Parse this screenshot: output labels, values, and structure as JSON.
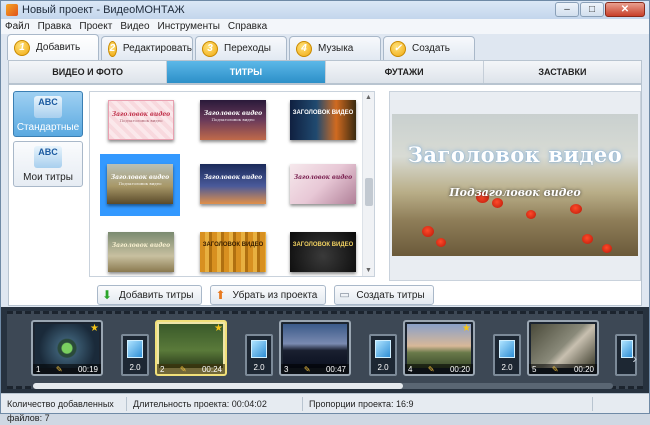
{
  "window": {
    "title": "Новый проект - ВидеоМОНТАЖ"
  },
  "menu": [
    "Файл",
    "Правка",
    "Проект",
    "Видео",
    "Инструменты",
    "Справка"
  ],
  "steps": [
    {
      "num": "1",
      "label": "Добавить"
    },
    {
      "num": "2",
      "label": "Редактировать"
    },
    {
      "num": "3",
      "label": "Переходы"
    },
    {
      "num": "4",
      "label": "Музыка"
    },
    {
      "num": "✓",
      "label": "Создать"
    }
  ],
  "subtabs": [
    "ВИДЕО И ФОТО",
    "ТИТРЫ",
    "ФУТАЖИ",
    "ЗАСТАВКИ"
  ],
  "leftnav": [
    {
      "icon": "ABC",
      "label": "Стандартные"
    },
    {
      "icon": "ABC",
      "label": "Мои титры"
    }
  ],
  "gallery": [
    {
      "title": "Заголовок видео",
      "sub": "Подзаголовок видео"
    },
    {
      "title": "Заголовок видео",
      "sub": "Подзаголовок видео"
    },
    {
      "title": "ЗАГОЛОВОК ВИДЕО",
      "sub": ""
    },
    {
      "title": "Заголовок видео",
      "sub": "Подзаголовок видео"
    },
    {
      "title": "Заголовок видео",
      "sub": ""
    },
    {
      "title": "Заголовок видео",
      "sub": ""
    },
    {
      "title": "Заголовок видео",
      "sub": ""
    },
    {
      "title": "ЗАГОЛОВОК ВИДЕО",
      "sub": ""
    },
    {
      "title": "ЗАГОЛОВОК ВИДЕО",
      "sub": ""
    }
  ],
  "preview": {
    "title": "Заголовок видео",
    "subtitle": "Подзаголовок видео"
  },
  "actions": [
    "Добавить титры",
    "Убрать из проекта",
    "Создать титры"
  ],
  "timeline": {
    "clips": [
      {
        "index": "1",
        "duration": "00:19"
      },
      {
        "index": "2",
        "duration": "00:24"
      },
      {
        "index": "3",
        "duration": "00:47"
      },
      {
        "index": "4",
        "duration": "00:20"
      },
      {
        "index": "5",
        "duration": "00:20"
      }
    ],
    "transition_value": "2.0"
  },
  "status": {
    "files": "Количество добавленных файлов: 7",
    "duration": "Длительность проекта: 00:04:02",
    "aspect": "Пропорции проекта: 16:9"
  }
}
